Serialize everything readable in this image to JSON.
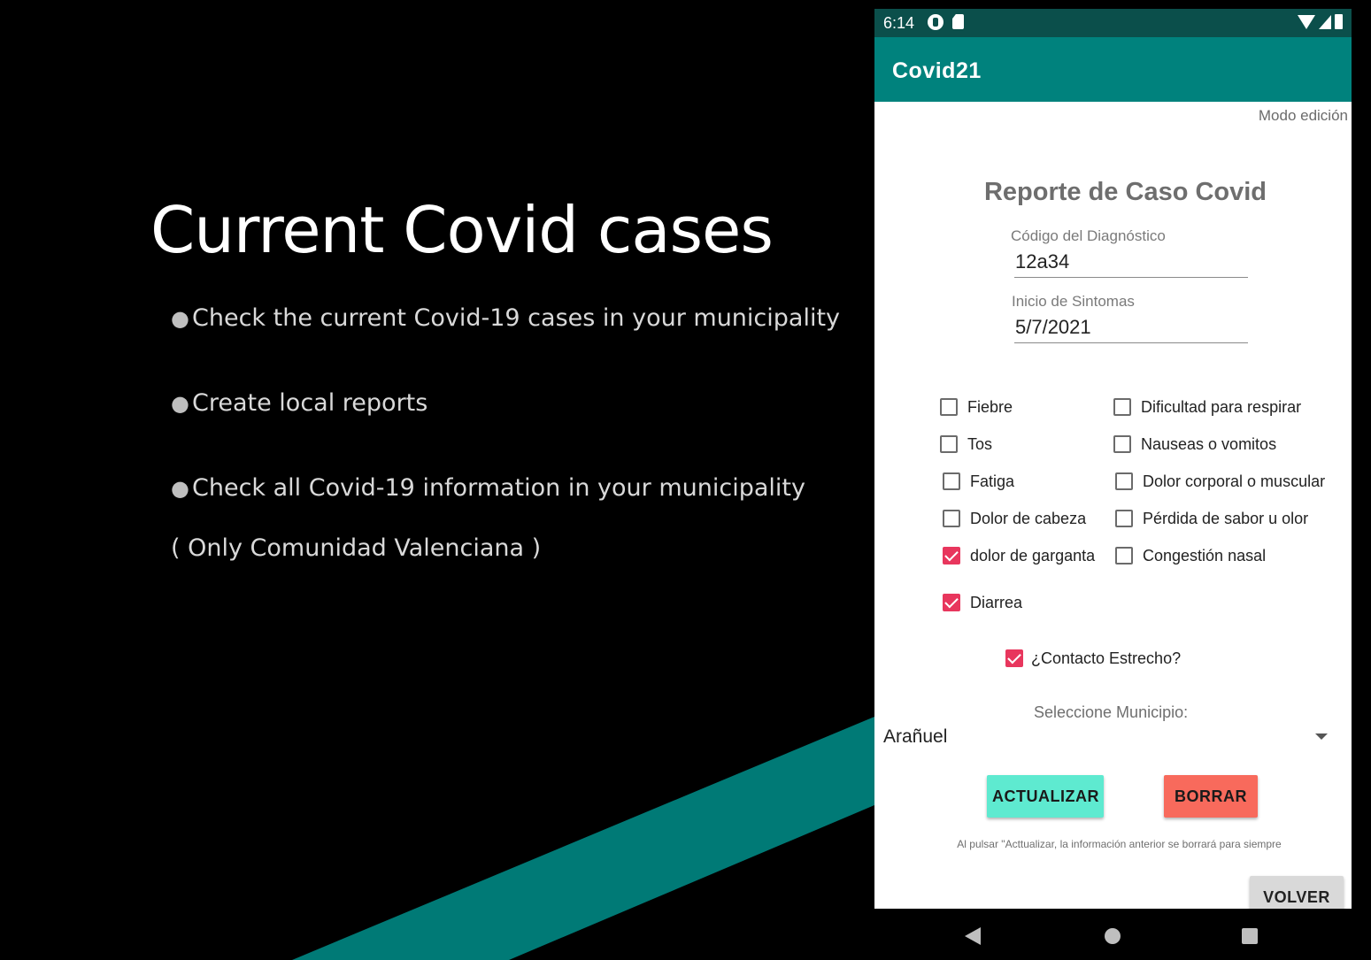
{
  "slide": {
    "title": "Current Covid cases",
    "bullets": [
      "Check the current Covid-19 cases in your municipality",
      "Create local reports",
      "Check all Covid-19  information in your municipality"
    ],
    "note": "( Only Comunidad Valenciana )",
    "accent_color": "#00827d"
  },
  "status_bar": {
    "time": "6:14",
    "icons": [
      "app-notification-icon",
      "sd-card-icon",
      "wifi-icon",
      "signal-icon",
      "battery-icon"
    ]
  },
  "app_bar": {
    "title": "Covid21",
    "color": "#00827d"
  },
  "form": {
    "mode": "Modo edición",
    "title": "Reporte de Caso Covid",
    "diagnosis_code": {
      "label": "Código del Diagnóstico",
      "value": "12a34"
    },
    "symptom_start": {
      "label": "Inicio de Sintomas",
      "value": "5/7/2021"
    },
    "symptoms_left": [
      {
        "label": "Fiebre",
        "checked": false
      },
      {
        "label": "Tos",
        "checked": false
      },
      {
        "label": "Fatiga",
        "checked": false
      },
      {
        "label": "Dolor de cabeza",
        "checked": false
      },
      {
        "label": "dolor de garganta",
        "checked": true
      },
      {
        "label": "Diarrea",
        "checked": true
      }
    ],
    "symptoms_right": [
      {
        "label": "Dificultad para respirar",
        "checked": false
      },
      {
        "label": "Nauseas o vomitos",
        "checked": false
      },
      {
        "label": "Dolor corporal o muscular",
        "checked": false
      },
      {
        "label": "Pérdida de sabor u olor",
        "checked": false
      },
      {
        "label": "Congestión nasal",
        "checked": false
      }
    ],
    "close_contact": {
      "label": "¿Contacto Estrecho?",
      "checked": true
    },
    "municipio": {
      "label": "Seleccione Municipio:",
      "selected": "Arañuel"
    },
    "update_button": "ACTUALIZAR",
    "delete_button": "BORRAR",
    "warning": "Al pulsar \"Acttualizar, la información anterior se borrará para siempre",
    "back_button": "VOLVER",
    "check_color": "#e8365d"
  },
  "nav_bar": {
    "icons": [
      "back-icon",
      "home-icon",
      "recents-icon"
    ]
  }
}
